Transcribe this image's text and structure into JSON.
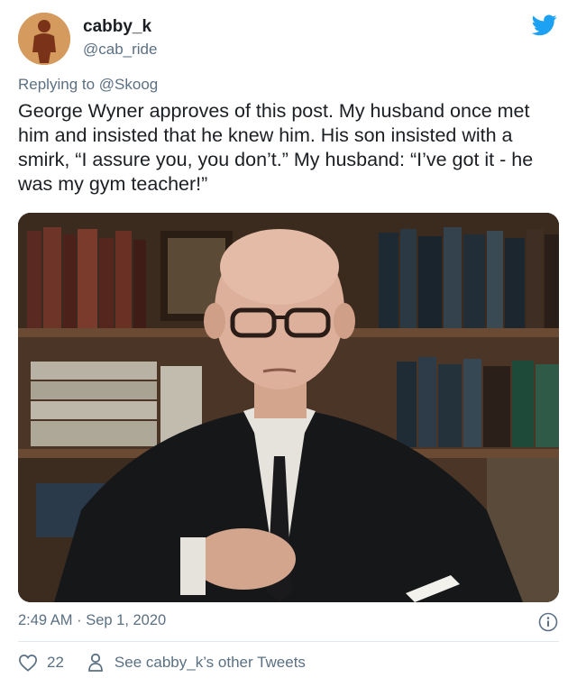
{
  "author": {
    "display_name": "cabby_k",
    "handle": "@cab_ride",
    "avatar_icon": "avatar-silhouette-icon",
    "avatar_color": "#d59a5e"
  },
  "brand": {
    "icon": "twitter-bird-icon",
    "color": "#1da1f2"
  },
  "reply": {
    "prefix": "Replying to",
    "mention": "@Skoog"
  },
  "tweet": {
    "text": "George Wyner approves of this post. My husband once met him and insisted that he knew him. His son insisted with a smirk, “I assure you, you don’t.” My husband: “I’ve got it - he was my gym teacher!”",
    "timestamp": "2:49 AM · Sep 1, 2020"
  },
  "media": {
    "subject": "photo of a bald man in glasses, suit and tie, seated in front of bookshelves"
  },
  "actions": {
    "like_count": "22",
    "other_tweets_label": "See cabby_k’s other Tweets"
  },
  "colors": {
    "secondary_text": "#5b7083",
    "divider": "#e1e8ed"
  }
}
